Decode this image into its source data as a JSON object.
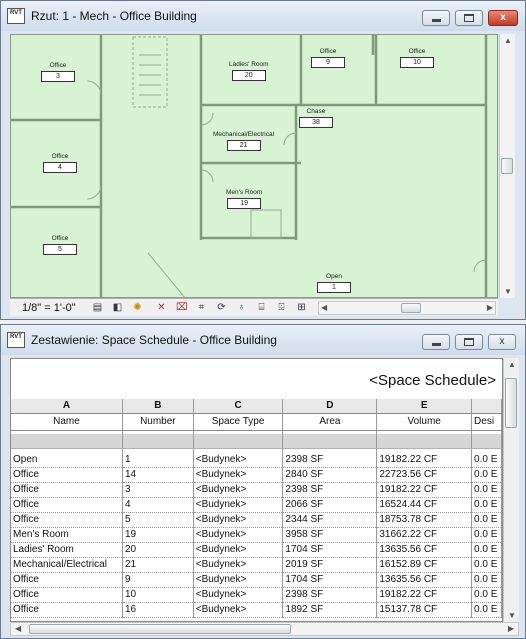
{
  "window1": {
    "title": "Rzut: 1 - Mech - Office Building",
    "icon_text": "RVT",
    "scale": "1/8\" = 1'-0\"",
    "rooms": [
      {
        "name": "Office",
        "number": "3"
      },
      {
        "name": "Office",
        "number": "4"
      },
      {
        "name": "Office",
        "number": "5"
      },
      {
        "name": "Ladies' Room",
        "number": "20"
      },
      {
        "name": "Office",
        "number": "9"
      },
      {
        "name": "Office",
        "number": "10"
      },
      {
        "name": "Chase",
        "number": "38"
      },
      {
        "name": "Mechanical/Electrical",
        "number": "21"
      },
      {
        "name": "Men's Room",
        "number": "19"
      },
      {
        "name": "Open",
        "number": "1"
      }
    ],
    "toolbar_icons": [
      "page-icon",
      "3d-box-icon",
      "sun-path-icon",
      "hide-icon",
      "isolate-icon",
      "show-hidden-icon",
      "analyze-icon",
      "temp-hide-icon",
      "lightbulb-icon",
      "crop-icon",
      "render-icon",
      "reveal-icon"
    ]
  },
  "window2": {
    "title": "Zestawienie: Space Schedule - Office Building",
    "icon_text": "RVT",
    "schedule_title": "<Space Schedule>",
    "column_letters": [
      "A",
      "B",
      "C",
      "D",
      "E",
      ""
    ],
    "column_headers": [
      "Name",
      "Number",
      "Space Type",
      "Area",
      "Volume",
      "Desi"
    ],
    "rows": [
      [
        "Open",
        "1",
        "<Budynek>",
        "2398 SF",
        "19182.22 CF",
        "0.0 E"
      ],
      [
        "Office",
        "14",
        "<Budynek>",
        "2840 SF",
        "22723.56 CF",
        "0.0 E"
      ],
      [
        "Office",
        "3",
        "<Budynek>",
        "2398 SF",
        "19182.22 CF",
        "0.0 E"
      ],
      [
        "Office",
        "4",
        "<Budynek>",
        "2066 SF",
        "16524.44 CF",
        "0.0 E"
      ],
      [
        "Office",
        "5",
        "<Budynek>",
        "2344 SF",
        "18753.78 CF",
        "0.0 E"
      ],
      [
        "Men's Room",
        "19",
        "<Budynek>",
        "3958 SF",
        "31662.22 CF",
        "0.0 E"
      ],
      [
        "Ladies' Room",
        "20",
        "<Budynek>",
        "1704 SF",
        "13635.56 CF",
        "0.0 E"
      ],
      [
        "Mechanical/Electrical",
        "21",
        "<Budynek>",
        "2019 SF",
        "16152.89 CF",
        "0.0 E"
      ],
      [
        "Office",
        "9",
        "<Budynek>",
        "1704 SF",
        "13635.56 CF",
        "0.0 E"
      ],
      [
        "Office",
        "10",
        "<Budynek>",
        "2398 SF",
        "19182.22 CF",
        "0.0 E"
      ],
      [
        "Office",
        "16",
        "<Budynek>",
        "1892 SF",
        "15137.78 CF",
        "0.0 E"
      ]
    ]
  },
  "window_controls": {
    "minimize": "",
    "maximize": "",
    "close": "x"
  }
}
